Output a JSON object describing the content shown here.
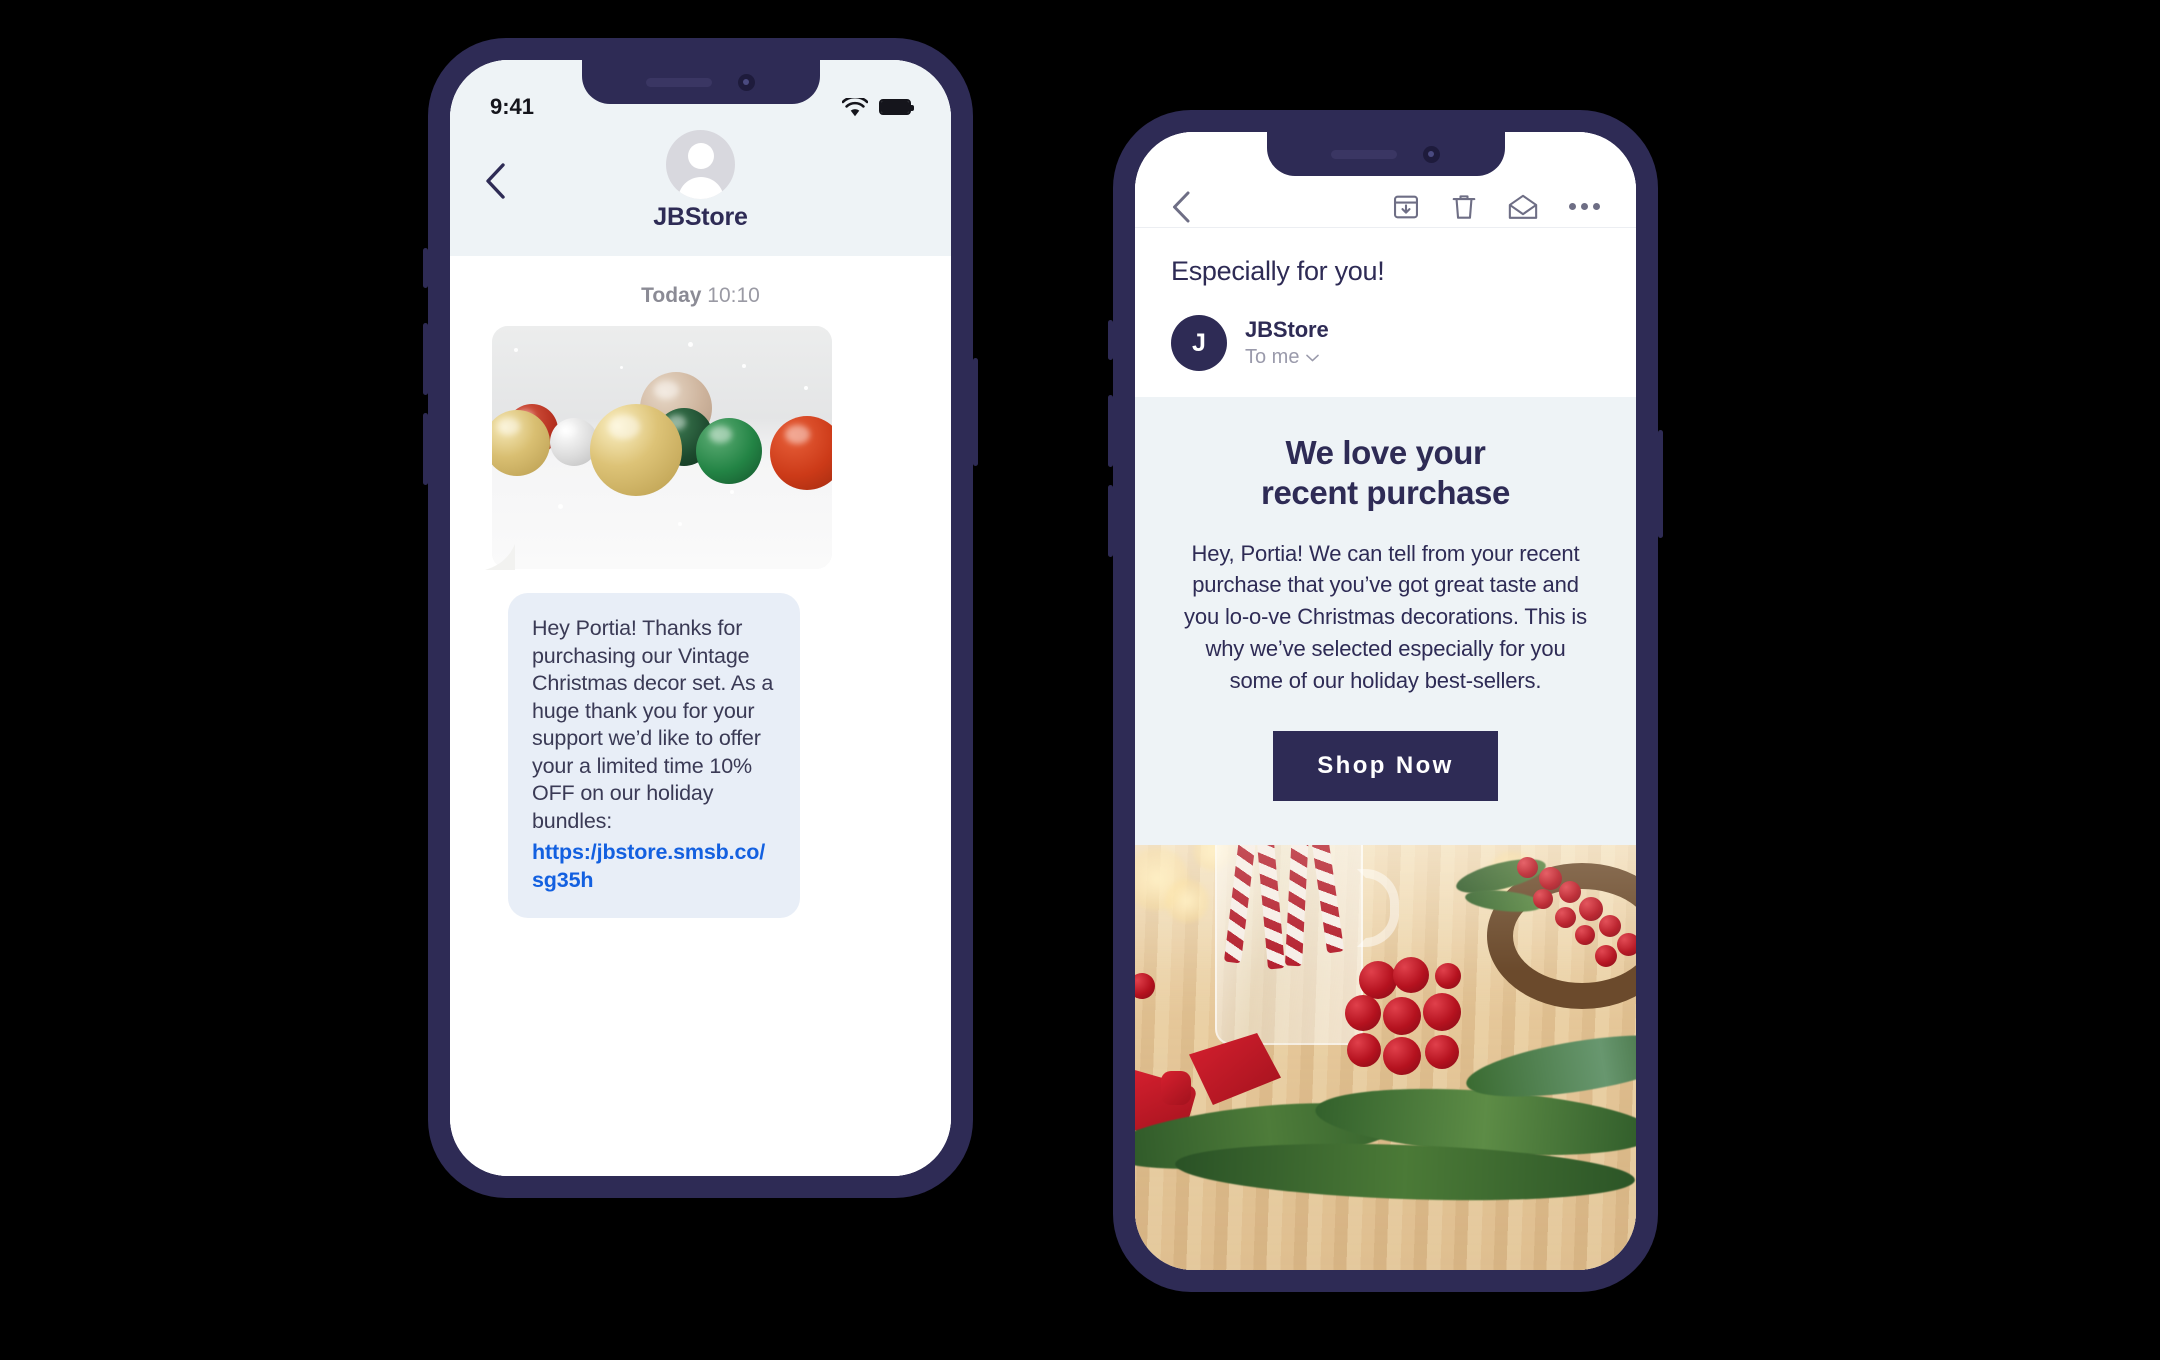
{
  "colors": {
    "navy": "#2e2b55",
    "panel_bg": "#eef3f6",
    "bubble_bg": "#e8eef7",
    "link_blue": "#1360e0",
    "white": "#ffffff"
  },
  "sms_phone": {
    "status_bar": {
      "time": "9:41",
      "wifi_icon": "wifi-icon",
      "battery_icon": "battery-icon"
    },
    "navbar": {
      "back_icon": "chevron-left-icon",
      "avatar_icon": "person-avatar-icon",
      "contact_name": "JBStore"
    },
    "conversation": {
      "day_label": "Today",
      "time_label": "10:10",
      "image_message": {
        "alt": "christmas-ornaments-photo"
      },
      "text_message": {
        "body": "Hey Portia! Thanks for purchasing our Vintage Christmas decor set. As a huge thank you for your support we’d like to offer your a limited time 10% OFF on our holiday bundles: ",
        "link": "https:/jbstore.smsb.co/sg35h"
      }
    }
  },
  "email_phone": {
    "toolbar": {
      "back_icon": "chevron-left-icon",
      "archive_icon": "archive-box-icon",
      "delete_icon": "trash-icon",
      "mail_icon": "envelope-open-icon",
      "more_icon": "more-options-icon"
    },
    "message": {
      "subject": "Especially for you!",
      "sender_initial": "J",
      "sender_name": "JBStore",
      "recipient": "To me",
      "recipient_caret": "chevron-down-icon"
    },
    "promo": {
      "title_line1": "We love your",
      "title_line2": "recent purchase",
      "body": "Hey, Portia! We can tell from your recent purchase that you’ve got great taste and you lo-o-ve Christmas decorations. This is why we’ve selected especially for you some of our holiday best-sellers.",
      "cta_label": "Shop Now",
      "hero_image_alt": "christmas-table-scene-photo"
    }
  }
}
